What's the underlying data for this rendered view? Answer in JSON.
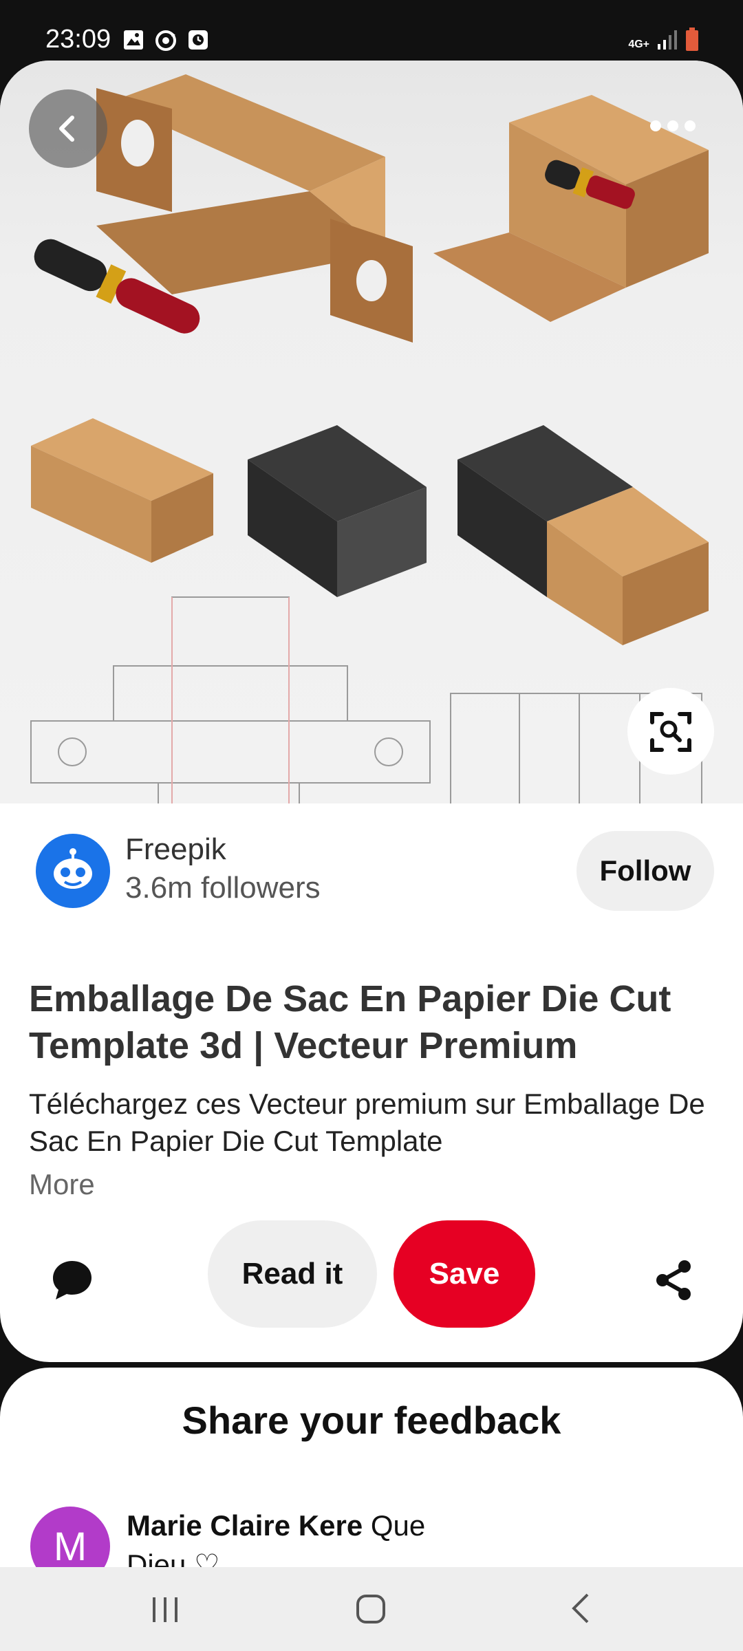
{
  "status_bar": {
    "time": "23:09",
    "network": "4G+",
    "icons_left": [
      "gallery-icon",
      "sync-icon",
      "clock-app-icon"
    ],
    "icons_right": [
      "signal-icon",
      "battery-icon"
    ]
  },
  "pin": {
    "hero_image": "die-cut box template illustration with lipstick",
    "creator": {
      "name": "Freepik",
      "followers": "3.6m followers",
      "follow_label": "Follow"
    },
    "title": "Emballage De Sac En Papier Die Cut Template 3d | Vecteur Premium",
    "description": "Téléchargez ces Vecteur premium sur Emballage De Sac En Papier Die Cut Template",
    "more_label": "More"
  },
  "actions": {
    "read_it_label": "Read it",
    "save_label": "Save"
  },
  "feedback": {
    "title": "Share your feedback",
    "comment": {
      "avatar_letter": "M",
      "author": "Marie Claire Kere",
      "text": "Que",
      "text_cont": "Dieu ♡"
    }
  },
  "colors": {
    "save_red": "#e60023",
    "creator_avatar_blue": "#1a73e8",
    "commenter_avatar_purple": "#b23bc9",
    "kraft_brown": "#c8935a"
  }
}
